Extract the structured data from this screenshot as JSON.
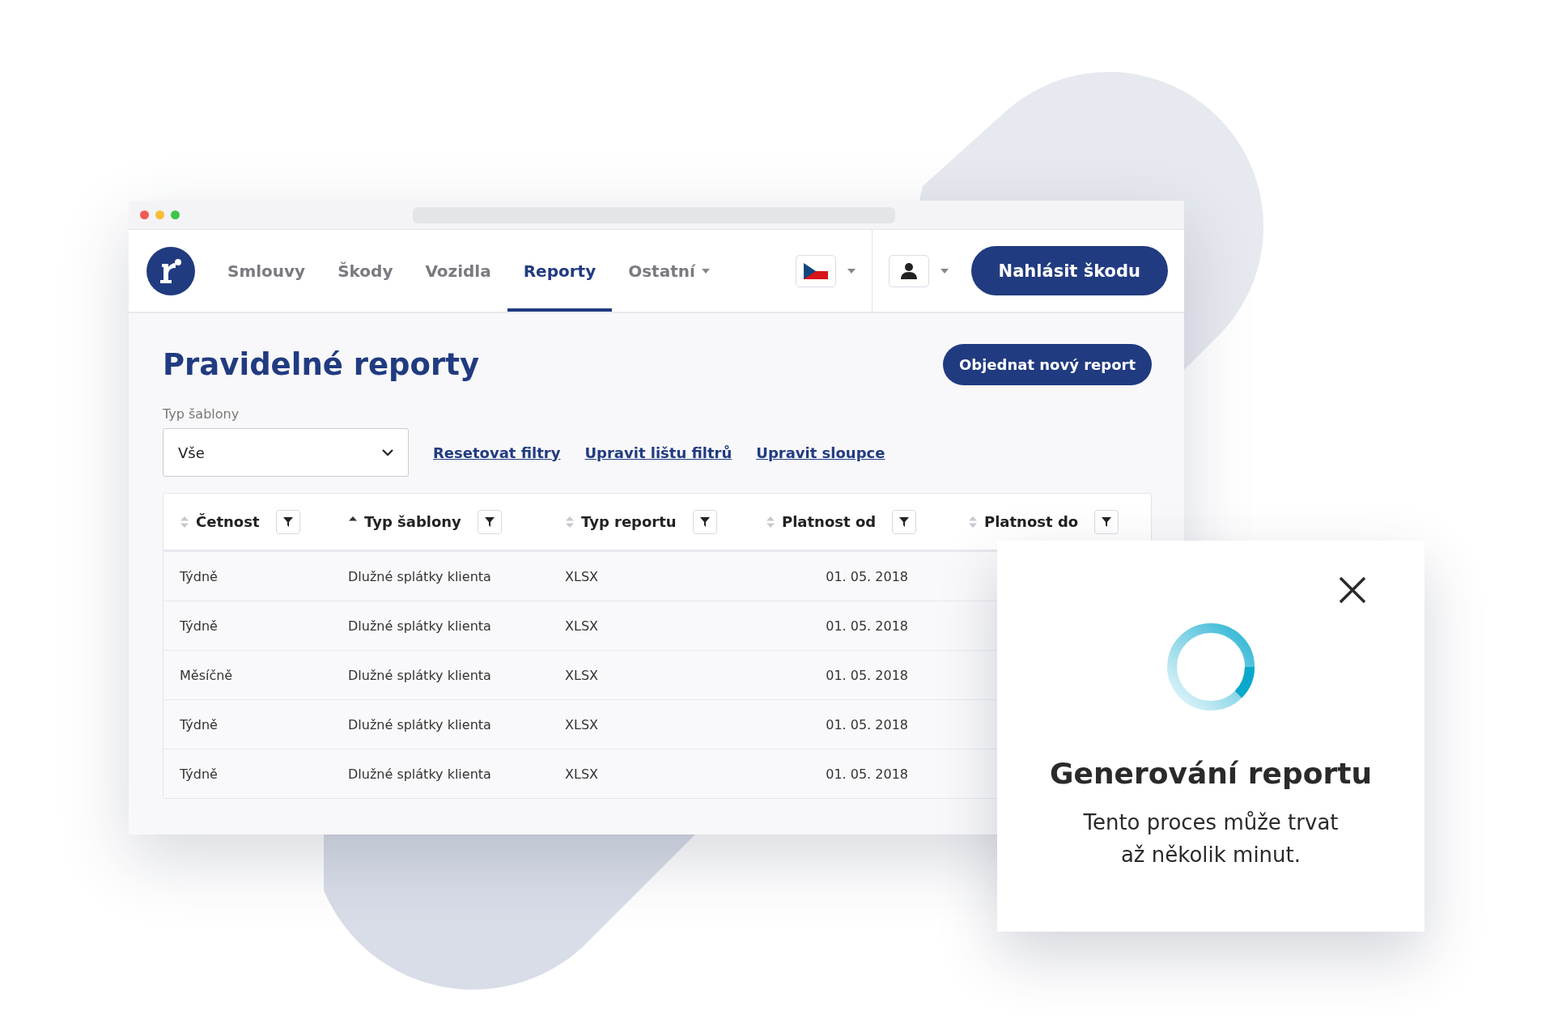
{
  "nav": {
    "tabs": [
      {
        "label": "Smlouvy",
        "selected": false,
        "dropdown": false
      },
      {
        "label": "Škody",
        "selected": false,
        "dropdown": false
      },
      {
        "label": "Vozidla",
        "selected": false,
        "dropdown": false
      },
      {
        "label": "Reporty",
        "selected": true,
        "dropdown": false
      },
      {
        "label": "Ostatní",
        "selected": false,
        "dropdown": true
      }
    ],
    "report_button": "Nahlásit škodu"
  },
  "page": {
    "title": "Pravidelné reporty",
    "order_button": "Objednat nový report",
    "filter": {
      "label": "Typ šablony",
      "value": "Vše"
    },
    "links": [
      "Resetovat filtry",
      "Upravit lištu filtrů",
      "Upravit sloupce"
    ]
  },
  "table": {
    "columns": [
      {
        "label": "Četnost",
        "sorted": false
      },
      {
        "label": "Typ šablony",
        "sorted": true
      },
      {
        "label": "Typ reportu",
        "sorted": false
      },
      {
        "label": "Platnost od",
        "sorted": false
      },
      {
        "label": "Platnost do",
        "sorted": false
      }
    ],
    "rows": [
      [
        "Týdně",
        "Dlužné splátky klienta",
        "XLSX",
        "01. 05. 2018"
      ],
      [
        "Týdně",
        "Dlužné splátky klienta",
        "XLSX",
        "01. 05. 2018"
      ],
      [
        "Měsíčně",
        "Dlužné splátky klienta",
        "XLSX",
        "01. 05. 2018"
      ],
      [
        "Týdně",
        "Dlužné splátky klienta",
        "XLSX",
        "01. 05. 2018"
      ],
      [
        "Týdně",
        "Dlužné splátky klienta",
        "XLSX",
        "01. 05. 2018"
      ]
    ]
  },
  "modal": {
    "title": "Generování reportu",
    "lines": [
      "Tento proces může trvat",
      "až několik minut."
    ]
  }
}
